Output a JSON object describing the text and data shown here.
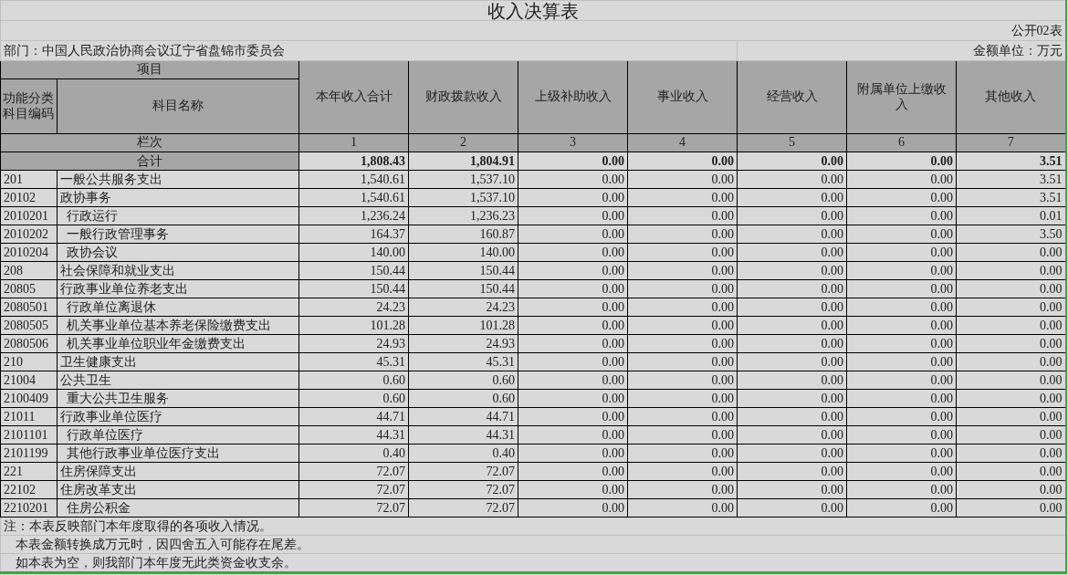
{
  "title": "收入决算表",
  "form_no": "公开02表",
  "department": "部门：中国人民政治协商会议辽宁省盘锦市委员会",
  "unit": "金额单位：万元",
  "header": {
    "project": "项目",
    "code_label": "功能分类科目编码",
    "name_label": "科目名称",
    "columns": [
      "本年收入合计",
      "财政拨款收入",
      "上级补助收入",
      "事业收入",
      "经营收入",
      "附属单位上缴收入",
      "其他收入"
    ]
  },
  "column_numbers": {
    "label": "栏次",
    "numbers": [
      "1",
      "2",
      "3",
      "4",
      "5",
      "6",
      "7"
    ]
  },
  "total": {
    "label": "合计",
    "values": [
      "1,808.43",
      "1,804.91",
      "0.00",
      "0.00",
      "0.00",
      "0.00",
      "3.51"
    ]
  },
  "rows": [
    {
      "code": "201",
      "name": "一般公共服务支出",
      "values": [
        "1,540.61",
        "1,537.10",
        "0.00",
        "0.00",
        "0.00",
        "0.00",
        "3.51"
      ],
      "children": [
        {
          "code": "20102",
          "name": "政协事务",
          "values": [
            "1,540.61",
            "1,537.10",
            "0.00",
            "0.00",
            "0.00",
            "0.00",
            "3.51"
          ],
          "children": [
            {
              "code": "2010201",
              "name": "行政运行",
              "values": [
                "1,236.24",
                "1,236.23",
                "0.00",
                "0.00",
                "0.00",
                "0.00",
                "0.01"
              ]
            },
            {
              "code": "2010202",
              "name": "一般行政管理事务",
              "values": [
                "164.37",
                "160.87",
                "0.00",
                "0.00",
                "0.00",
                "0.00",
                "3.50"
              ]
            },
            {
              "code": "2010204",
              "name": "政协会议",
              "values": [
                "140.00",
                "140.00",
                "0.00",
                "0.00",
                "0.00",
                "0.00",
                "0.00"
              ]
            }
          ]
        }
      ]
    },
    {
      "code": "208",
      "name": "社会保障和就业支出",
      "values": [
        "150.44",
        "150.44",
        "0.00",
        "0.00",
        "0.00",
        "0.00",
        "0.00"
      ],
      "children": [
        {
          "code": "20805",
          "name": "行政事业单位养老支出",
          "values": [
            "150.44",
            "150.44",
            "0.00",
            "0.00",
            "0.00",
            "0.00",
            "0.00"
          ],
          "children": [
            {
              "code": "2080501",
              "name": "行政单位离退休",
              "values": [
                "24.23",
                "24.23",
                "0.00",
                "0.00",
                "0.00",
                "0.00",
                "0.00"
              ]
            },
            {
              "code": "2080505",
              "name": "机关事业单位基本养老保险缴费支出",
              "values": [
                "101.28",
                "101.28",
                "0.00",
                "0.00",
                "0.00",
                "0.00",
                "0.00"
              ]
            },
            {
              "code": "2080506",
              "name": "机关事业单位职业年金缴费支出",
              "values": [
                "24.93",
                "24.93",
                "0.00",
                "0.00",
                "0.00",
                "0.00",
                "0.00"
              ]
            }
          ]
        }
      ]
    },
    {
      "code": "210",
      "name": "卫生健康支出",
      "values": [
        "45.31",
        "45.31",
        "0.00",
        "0.00",
        "0.00",
        "0.00",
        "0.00"
      ],
      "children": [
        {
          "code": "21004",
          "name": "公共卫生",
          "values": [
            "0.60",
            "0.60",
            "0.00",
            "0.00",
            "0.00",
            "0.00",
            "0.00"
          ],
          "children": [
            {
              "code": "2100409",
              "name": "重大公共卫生服务",
              "values": [
                "0.60",
                "0.60",
                "0.00",
                "0.00",
                "0.00",
                "0.00",
                "0.00"
              ]
            }
          ]
        },
        {
          "code": "21011",
          "name": "行政事业单位医疗",
          "values": [
            "44.71",
            "44.71",
            "0.00",
            "0.00",
            "0.00",
            "0.00",
            "0.00"
          ],
          "children": [
            {
              "code": "2101101",
              "name": "行政单位医疗",
              "values": [
                "44.31",
                "44.31",
                "0.00",
                "0.00",
                "0.00",
                "0.00",
                "0.00"
              ]
            },
            {
              "code": "2101199",
              "name": "其他行政事业单位医疗支出",
              "values": [
                "0.40",
                "0.40",
                "0.00",
                "0.00",
                "0.00",
                "0.00",
                "0.00"
              ]
            }
          ]
        }
      ]
    },
    {
      "code": "221",
      "name": "住房保障支出",
      "values": [
        "72.07",
        "72.07",
        "0.00",
        "0.00",
        "0.00",
        "0.00",
        "0.00"
      ],
      "children": [
        {
          "code": "22102",
          "name": "住房改革支出",
          "values": [
            "72.07",
            "72.07",
            "0.00",
            "0.00",
            "0.00",
            "0.00",
            "0.00"
          ],
          "children": [
            {
              "code": "2210201",
              "name": "住房公积金",
              "values": [
                "72.07",
                "72.07",
                "0.00",
                "0.00",
                "0.00",
                "0.00",
                "0.00"
              ]
            }
          ]
        }
      ]
    }
  ],
  "notes": [
    "注：本表反映部门本年度取得的各项收入情况。",
    "本表金额转换成万元时，因四舍五入可能存在尾差。",
    "如本表为空，则我部门本年度无此类资金收支余。"
  ]
}
